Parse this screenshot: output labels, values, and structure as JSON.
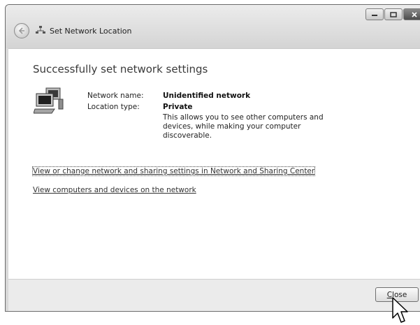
{
  "window": {
    "title": "Set Network Location"
  },
  "main": {
    "heading": "Successfully set network settings",
    "network_name_label": "Network name:",
    "network_name_value": "Unidentified network",
    "location_type_label": "Location type:",
    "location_type_value": "Private",
    "description": "This allows you to see other computers and devices, while making your computer discoverable.",
    "links": [
      "View or change network and sharing settings in Network and Sharing Center",
      "View computers and devices on the network"
    ]
  },
  "footer": {
    "close_label_underlined": "C",
    "close_label_rest": "lose"
  },
  "icons": {
    "back": "back-arrow-icon",
    "network": "network-icon",
    "computer": "computer-icon",
    "cursor": "mouse-pointer-icon"
  }
}
